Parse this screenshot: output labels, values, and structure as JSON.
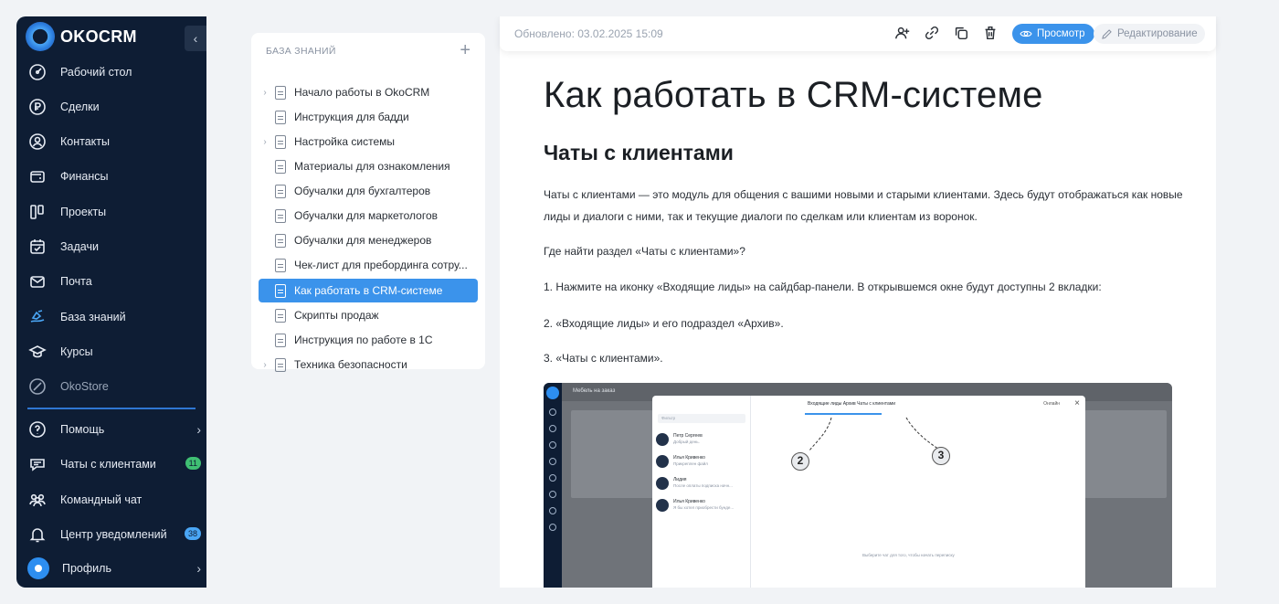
{
  "brand": {
    "name": "OKOCRM",
    "collapse_icon": "‹"
  },
  "nav": {
    "items": [
      {
        "label": "Рабочий стол",
        "icon": "dashboard-icon"
      },
      {
        "label": "Сделки",
        "icon": "ruble-icon"
      },
      {
        "label": "Контакты",
        "icon": "contact-icon"
      },
      {
        "label": "Финансы",
        "icon": "wallet-icon"
      },
      {
        "label": "Проекты",
        "icon": "projects-icon"
      },
      {
        "label": "Задачи",
        "icon": "tasks-icon"
      },
      {
        "label": "Почта",
        "icon": "mail-icon"
      },
      {
        "label": "База знаний",
        "icon": "knowledge-icon"
      },
      {
        "label": "Курсы",
        "icon": "courses-icon"
      },
      {
        "label": "OkoStore",
        "icon": "store-icon"
      }
    ],
    "bottom": [
      {
        "label": "Помощь",
        "icon": "help-icon"
      },
      {
        "label": "Чаты с клиентами",
        "icon": "chat-icon",
        "badge": "11",
        "badge_color": "#3fbf73"
      },
      {
        "label": "Командный чат",
        "icon": "team-icon"
      },
      {
        "label": "Центр уведомлений",
        "icon": "bell-icon",
        "badge": "38",
        "badge_color": "#4aa6f5"
      },
      {
        "label": "Профиль",
        "icon": "profile-icon"
      }
    ]
  },
  "tree": {
    "header": "БАЗА ЗНАНИЙ",
    "add_icon": "+",
    "items": [
      {
        "label": "Начало работы в OkoCRM",
        "expandable": true
      },
      {
        "label": "Инструкция для бадди",
        "expandable": false
      },
      {
        "label": "Настройка системы",
        "expandable": true
      },
      {
        "label": "Материалы для ознакомления",
        "expandable": false
      },
      {
        "label": "Обучалки для бухгалтеров",
        "expandable": false
      },
      {
        "label": "Обучалки для маркетологов",
        "expandable": false
      },
      {
        "label": "Обучалки для менеджеров",
        "expandable": false
      },
      {
        "label": "Чек-лист для пребординга сотру...",
        "expandable": false
      },
      {
        "label": "Как работать в CRM-системе",
        "expandable": false,
        "active": true
      },
      {
        "label": "Скрипты продаж",
        "expandable": false
      },
      {
        "label": "Инструкция по работе в 1С",
        "expandable": false
      },
      {
        "label": "Техника безопасности",
        "expandable": true
      }
    ]
  },
  "toolbar": {
    "updated": "Обновлено: 03.02.2025 15:09",
    "view_label": "Просмотр",
    "edit_label": "Редактирование"
  },
  "article": {
    "title": "Как работать в CRM-системе",
    "subtitle": "Чаты с клиентами",
    "p1": "Чаты с клиентами — это модуль для общения с вашими новыми и старыми клиентами. Здесь будут отображаться как новые лиды и диалоги с ними, так и текущие диалоги по сделкам или клиентам из воронок.",
    "p2": "Где найти раздел «Чаты с клиентами»?",
    "p3": "1. Нажмите на иконку «Входящие лиды» на сайдбар-панели. В открывшемся окне будут доступны 2 вкладки:",
    "p4": "2. «Входящие лиды» и его подраздел «Архив».",
    "p5": "3. «Чаты с клиентами»."
  },
  "screenshot": {
    "title": "Мебель на заказ",
    "search": "Фильтр",
    "tabs": "Входящие лиды      Архив          Чаты с клиентами",
    "online": "Онлайн",
    "empty": "Выберите чат для того, чтобы начать переписку",
    "chats": [
      {
        "name": "Петр Сергеев",
        "msg": "Добрый день."
      },
      {
        "name": "Илья Кривенко",
        "msg": "Прикреплен файл"
      },
      {
        "name": "Лидия",
        "msg": "После оплаты подписка начн..."
      },
      {
        "name": "Илья Кривенко",
        "msg": "Я бы хотел приобрести бунде..."
      }
    ],
    "callout_2": "2",
    "callout_3": "3"
  }
}
